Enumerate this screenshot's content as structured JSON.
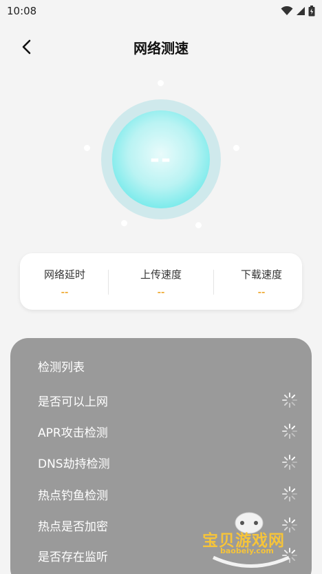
{
  "status_bar": {
    "time": "10:08"
  },
  "header": {
    "title": "网络测速"
  },
  "gauge": {
    "value": "--"
  },
  "metrics": [
    {
      "label": "网络延时",
      "value": "--"
    },
    {
      "label": "上传速度",
      "value": "--"
    },
    {
      "label": "下载速度",
      "value": "--"
    }
  ],
  "checklist": {
    "title": "检测列表",
    "items": [
      {
        "label": "是否可以上网",
        "status": "loading"
      },
      {
        "label": "APR攻击检测",
        "status": "loading"
      },
      {
        "label": "DNS劫持检测",
        "status": "loading"
      },
      {
        "label": "热点钓鱼检测",
        "status": "loading"
      },
      {
        "label": "热点是否加密",
        "status": "loading"
      },
      {
        "label": "是否存在监听",
        "status": "loading"
      }
    ]
  },
  "watermark": {
    "text": "宝贝游戏网",
    "url": "baobeiy.com"
  },
  "colors": {
    "accent": "#56e2e4",
    "ring": "#cfe9ec",
    "metric_value": "#f0b040",
    "panel": "#9a9a9a"
  }
}
